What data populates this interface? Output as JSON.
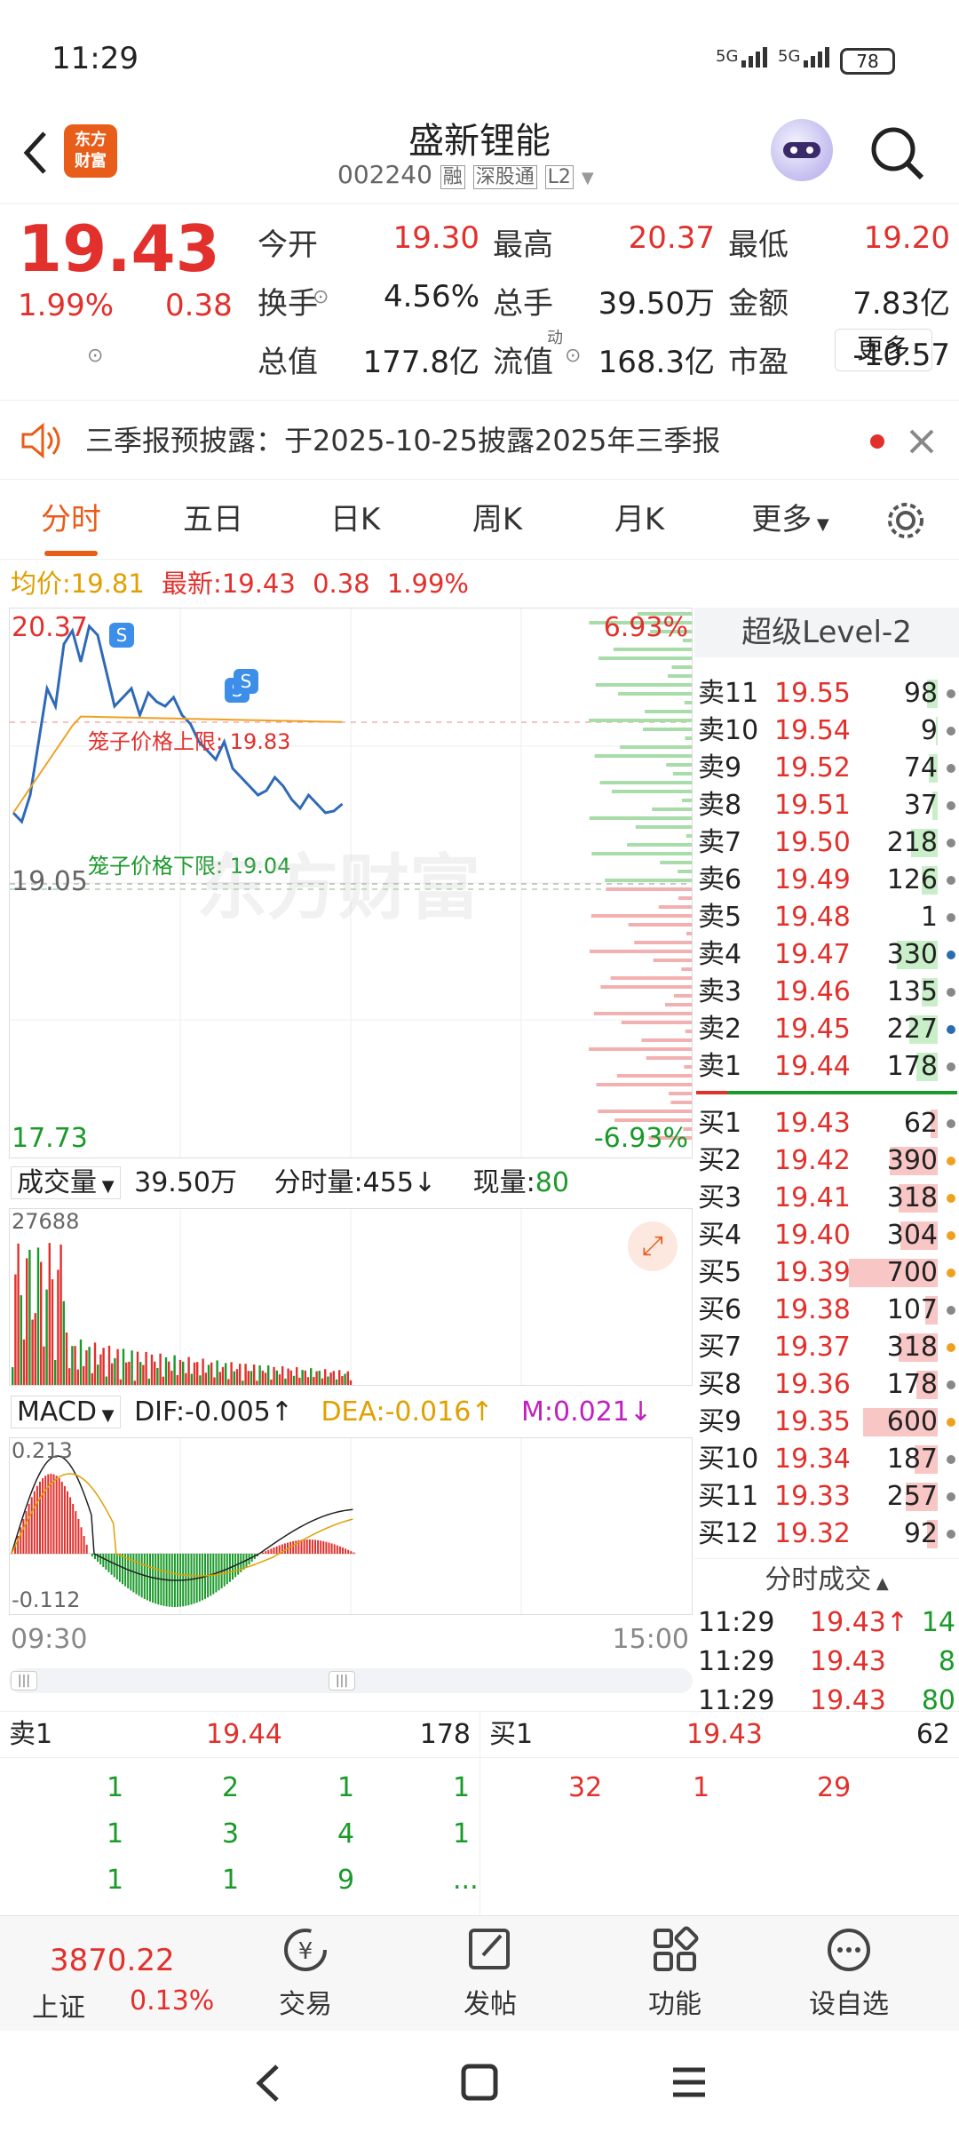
{
  "status": {
    "time": "11:29",
    "signal1": "5G",
    "signal2": "5G",
    "battery": "78"
  },
  "header": {
    "title": "盛新锂能",
    "code": "002240",
    "badges": [
      "融",
      "深股通",
      "L2"
    ],
    "brand": "东方\n财富"
  },
  "quote": {
    "price": "19.43",
    "pct": "1.99%",
    "chg": "0.38",
    "fields": [
      {
        "label": "今开",
        "value": "19.30",
        "color": "red"
      },
      {
        "label": "最高",
        "value": "20.37",
        "color": "red"
      },
      {
        "label": "最低",
        "value": "19.20",
        "color": "red"
      },
      {
        "label": "换手",
        "value": "4.56%",
        "color": "dark"
      },
      {
        "label": "总手",
        "value": "39.50万",
        "color": "dark"
      },
      {
        "label": "金额",
        "value": "7.83亿",
        "color": "dark"
      },
      {
        "label": "总值",
        "value": "177.8亿",
        "color": "dark"
      },
      {
        "label": "流值",
        "value": "168.3亿",
        "color": "dark"
      },
      {
        "label": "市盈",
        "value": "-10.57",
        "color": "dark"
      }
    ],
    "pe_sup": "动",
    "more": "更多"
  },
  "notice": {
    "text": "三季报预披露：于2025-10-25披露2025年三季报"
  },
  "tabs": [
    "分时",
    "五日",
    "日K",
    "周K",
    "月K",
    "更多"
  ],
  "avg": {
    "avg_label": "均价:",
    "avg_val": "19.81",
    "last_label": "最新:",
    "last_val": "19.43",
    "chg": "0.38",
    "pct": "1.99%"
  },
  "chart": {
    "top": "20.37",
    "top_pct": "6.93%",
    "bottom": "17.73",
    "bottom_pct": "-6.93%",
    "prev": "19.05",
    "upper_label": "笼子价格上限:",
    "upper_val": "19.83",
    "lower_label": "笼子价格下限:",
    "lower_val": "19.04",
    "watermark": "东方财富"
  },
  "vol": {
    "label": "成交量",
    "total": "39.50万",
    "fs_label": "分时量:",
    "fs_val": "455↓",
    "xl_label": "现量:",
    "xl_val": "80",
    "max": "27688"
  },
  "macd": {
    "label": "MACD",
    "dif": "DIF:-0.005↑",
    "dea": "DEA:-0.016↑",
    "m": "M:0.021↓",
    "top": "0.213",
    "bottom": "-0.112"
  },
  "time_axis": {
    "start": "09:30",
    "end": "15:00"
  },
  "book": {
    "title": "超级Level-2",
    "asks": [
      {
        "label": "卖11",
        "price": "19.55",
        "qty": "98",
        "bar": 0.06,
        "dot": "gray"
      },
      {
        "label": "卖10",
        "price": "19.54",
        "qty": "9",
        "bar": 0.01,
        "dot": "gray"
      },
      {
        "label": "卖9",
        "price": "19.52",
        "qty": "74",
        "bar": 0.05,
        "dot": "gray"
      },
      {
        "label": "卖8",
        "price": "19.51",
        "qty": "37",
        "bar": 0.03,
        "dot": "gray"
      },
      {
        "label": "卖7",
        "price": "19.50",
        "qty": "218",
        "bar": 0.15,
        "dot": "gray"
      },
      {
        "label": "卖6",
        "price": "19.49",
        "qty": "126",
        "bar": 0.09,
        "dot": "gray"
      },
      {
        "label": "卖5",
        "price": "19.48",
        "qty": "1",
        "bar": 0.0,
        "dot": "gray"
      },
      {
        "label": "卖4",
        "price": "19.47",
        "qty": "330",
        "bar": 0.23,
        "dot": "blue"
      },
      {
        "label": "卖3",
        "price": "19.46",
        "qty": "135",
        "bar": 0.09,
        "dot": "gray"
      },
      {
        "label": "卖2",
        "price": "19.45",
        "qty": "227",
        "bar": 0.16,
        "dot": "blue"
      },
      {
        "label": "卖1",
        "price": "19.44",
        "qty": "178",
        "bar": 0.12,
        "dot": "gray"
      }
    ],
    "bids": [
      {
        "label": "买1",
        "price": "19.43",
        "qty": "62",
        "bar": 0.04,
        "dot": "gray"
      },
      {
        "label": "买2",
        "price": "19.42",
        "qty": "390",
        "bar": 0.27,
        "dot": "orange"
      },
      {
        "label": "买3",
        "price": "19.41",
        "qty": "318",
        "bar": 0.22,
        "dot": "orange"
      },
      {
        "label": "买4",
        "price": "19.40",
        "qty": "304",
        "bar": 0.21,
        "dot": "orange"
      },
      {
        "label": "买5",
        "price": "19.39",
        "qty": "700",
        "bar": 0.5,
        "dot": "orange"
      },
      {
        "label": "买6",
        "price": "19.38",
        "qty": "107",
        "bar": 0.07,
        "dot": "gray"
      },
      {
        "label": "买7",
        "price": "19.37",
        "qty": "318",
        "bar": 0.22,
        "dot": "orange"
      },
      {
        "label": "买8",
        "price": "19.36",
        "qty": "178",
        "bar": 0.12,
        "dot": "gray"
      },
      {
        "label": "买9",
        "price": "19.35",
        "qty": "600",
        "bar": 0.42,
        "dot": "orange"
      },
      {
        "label": "买10",
        "price": "19.34",
        "qty": "187",
        "bar": 0.13,
        "dot": "gray"
      },
      {
        "label": "买11",
        "price": "19.33",
        "qty": "257",
        "bar": 0.18,
        "dot": "gray"
      },
      {
        "label": "买12",
        "price": "19.32",
        "qty": "92",
        "bar": 0.06,
        "dot": "gray"
      }
    ],
    "ticks_title": "分时成交",
    "ticks": [
      {
        "time": "11:29",
        "price": "19.43↑",
        "qty": "14"
      },
      {
        "time": "11:29",
        "price": "19.43",
        "qty": "8"
      },
      {
        "time": "11:29",
        "price": "19.43",
        "qty": "80"
      }
    ]
  },
  "level": {
    "ask_label": "卖1",
    "ask_price": "19.44",
    "ask_qty": "178",
    "bid_label": "买1",
    "bid_price": "19.43",
    "bid_qty": "62",
    "ask_orders": [
      [
        "1",
        "2",
        "1",
        "1"
      ],
      [
        "1",
        "3",
        "4",
        "1"
      ],
      [
        "1",
        "1",
        "9",
        "..."
      ]
    ],
    "bid_orders": [
      "32",
      "1",
      "29"
    ]
  },
  "bottom": {
    "index_val": "3870.22",
    "index_name": "上证",
    "index_pct": "0.13%",
    "nav": [
      "交易",
      "发帖",
      "功能",
      "设自选"
    ]
  },
  "colors": {
    "red": "#e2302c",
    "green": "#1a9a2a",
    "blue": "#2b6cb0",
    "orange": "#f0a020",
    "accent": "#e85d1a"
  }
}
